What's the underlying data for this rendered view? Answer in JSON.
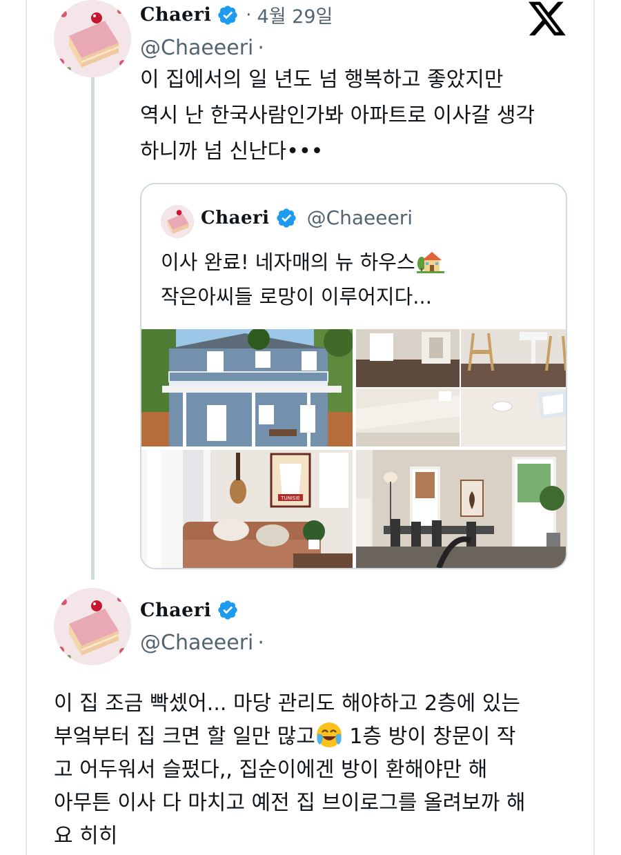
{
  "tweet1": {
    "display_name": "Chaeri",
    "handle": "@Chaeeeri",
    "handle_separator": "·",
    "date_separator": "·",
    "date": "4월 29일",
    "text_lines": [
      "이 집에서의 일 년도 넘 행복하고 좋았지만",
      "역시 난 한국사람인가봐 아파트로 이사갈 생각",
      "하니까 넘 신난다•••"
    ]
  },
  "platform": {
    "logo_icon": "x-logo-icon"
  },
  "quote": {
    "display_name": "Chaeri",
    "handle": "@Chaeeeri",
    "text_line1": "이사 완료! 네자매의 뉴 하우스",
    "text_line1_emoji": "house-with-garden-emoji",
    "text_line2": "작은아씨들 로망이 이루어지다...",
    "photos": [
      "house-exterior-photo",
      "hallway-photo",
      "dining-chairs-photo",
      "ceiling-photo",
      "skylight-photo",
      "living-room-photo",
      "dining-room-photo"
    ],
    "poster_text": "TUNISIE"
  },
  "reply": {
    "display_name": "Chaeri",
    "handle": "@Chaeeeri",
    "handle_separator": "·",
    "line1": "이 집 조금 빡셌어... 마당 관리도 해야하고 2층에 있는",
    "line2_before_emoji": "부엌부터 집 크면 할 일만 많고",
    "line2_emoji": "crying-laughing-emoji",
    "line2_after_emoji": " 1층 방이 창문이 작",
    "line3": "고 어두워서 슬펐다,, 집순이에겐 방이 환해야만 해",
    "line4": "아무튼 이사 다 마치고 예전 집 브이로그를 올려보까 해",
    "line5": "요 히히"
  },
  "colors": {
    "verified_blue": "#1d9bf0",
    "secondary_text": "#536471",
    "border": "#cfd9de",
    "text": "#0f1419"
  }
}
